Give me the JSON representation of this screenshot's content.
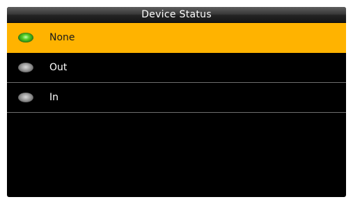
{
  "header": {
    "title": "Device Status"
  },
  "options": [
    {
      "label": "None",
      "selected": true
    },
    {
      "label": "Out",
      "selected": false
    },
    {
      "label": "In",
      "selected": false
    }
  ],
  "colors": {
    "highlight": "#ffb300",
    "background": "#000000",
    "radio_on": "#3fb81a",
    "radio_off": "#9a9a9a"
  },
  "icons": {
    "radio_on": "radio-selected-icon",
    "radio_off": "radio-unselected-icon"
  }
}
